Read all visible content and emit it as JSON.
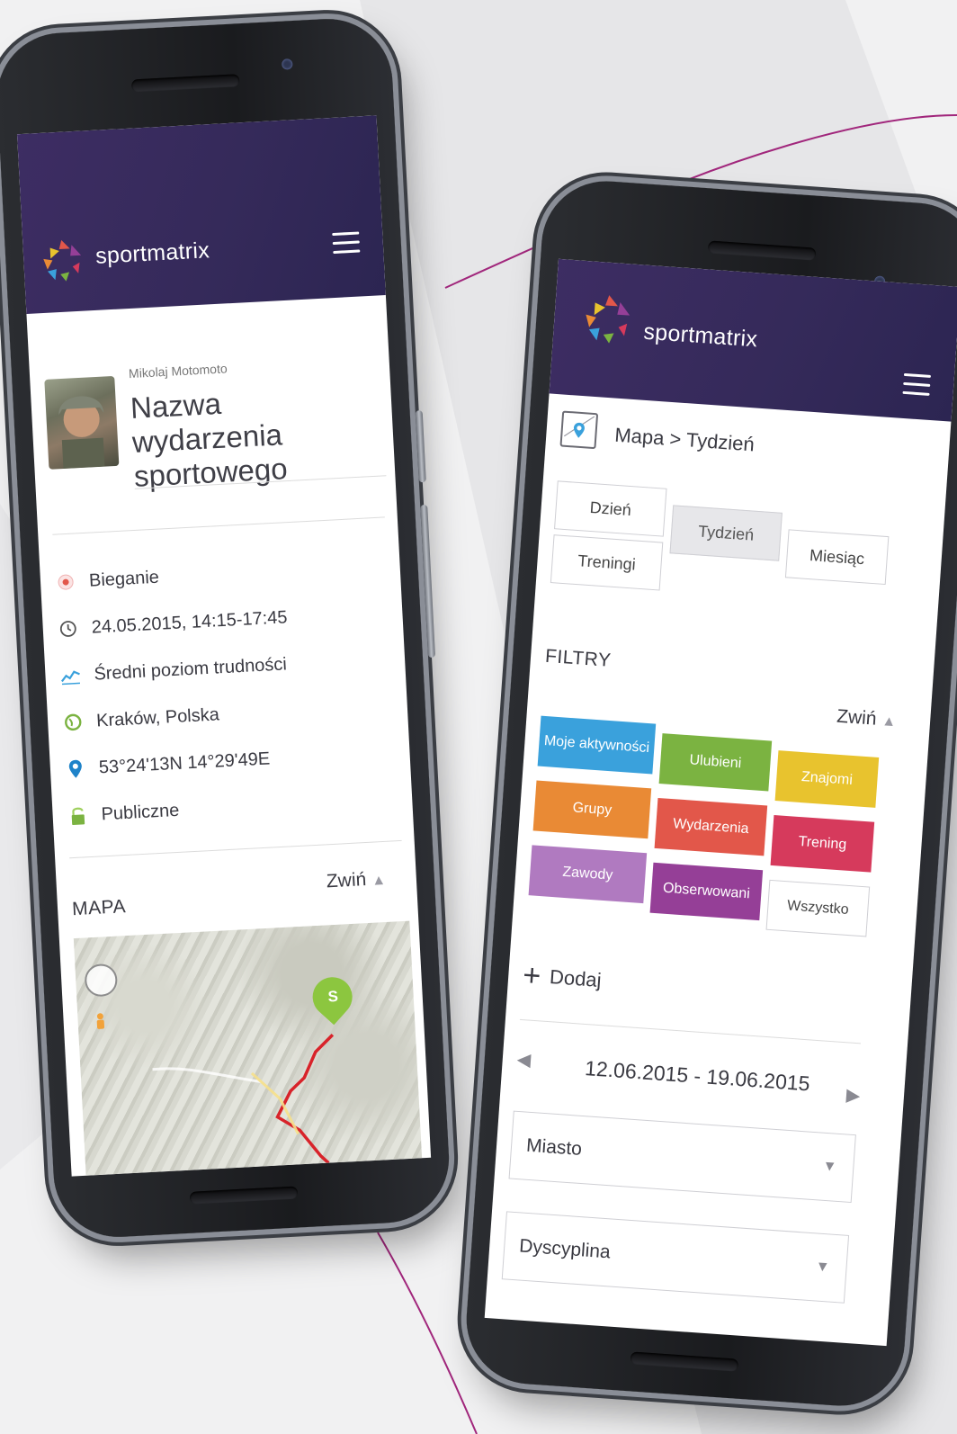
{
  "colors": {
    "header_purple": "#3d2d63",
    "accent_line": "#a1277c",
    "blue": "#3aa1dc",
    "green": "#7bb341",
    "yellow": "#e8c32e",
    "orange": "#e98a35",
    "red": "#e2574a",
    "crimson": "#d63a5c",
    "lilac": "#b07ac0",
    "purple": "#953f97"
  },
  "left_phone": {
    "brand": "sportmatrix",
    "menu_icon": "hamburger-icon",
    "author": "Mikolaj Motomoto",
    "event_title": "Nazwa wydarzenia sportowego",
    "info": [
      {
        "icon": "activity-dot-icon",
        "text": "Bieganie"
      },
      {
        "icon": "clock-icon",
        "text": "24.05.2015, 14:15-17:45"
      },
      {
        "icon": "difficulty-chart-icon",
        "text": "Średni poziom trudności"
      },
      {
        "icon": "location-globe-icon",
        "text": "Kraków, Polska"
      },
      {
        "icon": "map-pin-icon",
        "text": "53°24'13N 14°29'49E"
      },
      {
        "icon": "padlock-icon",
        "text": "Publiczne"
      }
    ],
    "map_section": {
      "title": "MAPA",
      "collapse_label": "Zwiń",
      "pin_label": "S"
    }
  },
  "right_phone": {
    "brand": "sportmatrix",
    "menu_icon": "hamburger-icon",
    "breadcrumb": "Mapa > Tydzień",
    "tabs": [
      {
        "label": "Dzień",
        "active": false
      },
      {
        "label": "Tydzień",
        "active": true
      },
      {
        "label": "Miesiąc",
        "active": false
      },
      {
        "label": "Treningi",
        "active": false
      }
    ],
    "filters_title": "FILTRY",
    "collapse_label": "Zwiń",
    "filters": [
      {
        "label": "Moje aktywności",
        "color": "#3aa1dc"
      },
      {
        "label": "Ulubieni",
        "color": "#7bb341"
      },
      {
        "label": "Znajomi",
        "color": "#e8c32e"
      },
      {
        "label": "Grupy",
        "color": "#e98a35"
      },
      {
        "label": "Wydarzenia",
        "color": "#e2574a"
      },
      {
        "label": "Trening",
        "color": "#d63a5c"
      },
      {
        "label": "Zawody",
        "color": "#b07ac0"
      },
      {
        "label": "Obserwowani",
        "color": "#953f97"
      },
      {
        "label": "Wszystko",
        "color": "#ffffff"
      }
    ],
    "add_label": "Dodaj",
    "date_range": "12.06.2015 - 19.06.2015",
    "selects": [
      {
        "label": "Miasto"
      },
      {
        "label": "Dyscyplina"
      }
    ]
  }
}
